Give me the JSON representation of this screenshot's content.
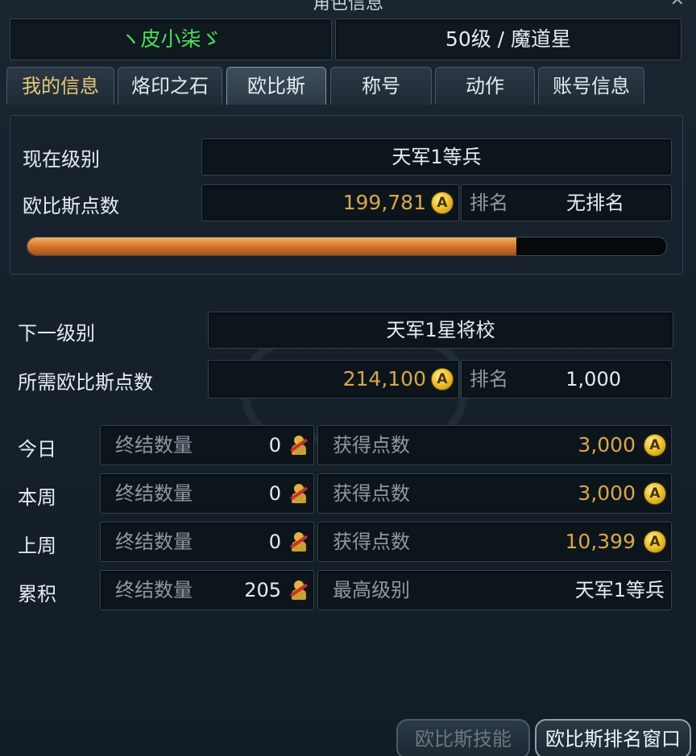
{
  "window": {
    "title": "角色信息"
  },
  "header": {
    "character_name": "ヽ皮小柒ゞ",
    "level_class": "50级 / 魔道星"
  },
  "tabs": [
    {
      "label": "我的信息",
      "active": false
    },
    {
      "label": "烙印之石",
      "active": false
    },
    {
      "label": "欧比斯",
      "active": true
    },
    {
      "label": "称号",
      "active": false
    },
    {
      "label": "动作",
      "active": false
    },
    {
      "label": "账号信息",
      "active": false
    }
  ],
  "current": {
    "level_label": "现在级别",
    "level_value": "天军1等兵",
    "points_label": "欧比斯点数",
    "points_value": "199,781",
    "rank_label": "排名",
    "rank_value": "无排名",
    "progress_fraction": 0.766
  },
  "next": {
    "level_label": "下一级别",
    "level_value": "天军1星将校",
    "points_label": "所需欧比斯点数",
    "points_value": "214,100",
    "rank_label": "排名",
    "rank_value": "1,000"
  },
  "stats": [
    {
      "period": "今日",
      "kills_label": "终结数量",
      "kills": "0",
      "right_label": "获得点数",
      "right_value": "3,000",
      "right_is_points": true
    },
    {
      "period": "本周",
      "kills_label": "终结数量",
      "kills": "0",
      "right_label": "获得点数",
      "right_value": "3,000",
      "right_is_points": true
    },
    {
      "period": "上周",
      "kills_label": "终结数量",
      "kills": "0",
      "right_label": "获得点数",
      "right_value": "10,399",
      "right_is_points": true
    },
    {
      "period": "累积",
      "kills_label": "终结数量",
      "kills": "205",
      "right_label": "最高级别",
      "right_value": "天军1等兵",
      "right_is_points": false
    }
  ],
  "coin_letter": "A",
  "buttons": {
    "skills": "欧比斯技能",
    "ranking": "欧比斯排名窗口"
  },
  "icons": {
    "close": "close-icon",
    "coin": "abyss-point-coin-icon",
    "kill": "kill-count-icon"
  },
  "colors": {
    "name": "#4ce05c",
    "points": "#d9a74a",
    "progress": "#d9792e"
  }
}
